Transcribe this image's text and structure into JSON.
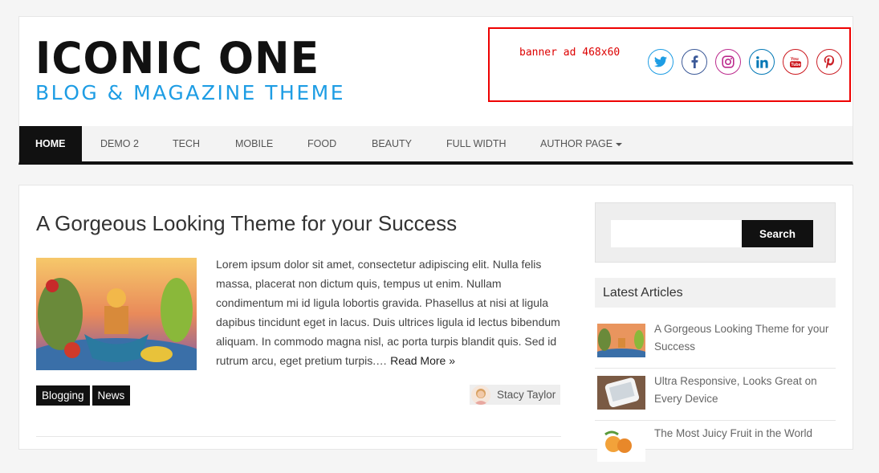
{
  "header": {
    "site_title": "ICONIC ONE",
    "tagline": "BLOG & MAGAZINE THEME",
    "banner_text": "banner ad 468x60",
    "social": [
      {
        "name": "twitter-icon",
        "glyph": "t",
        "color": "#1e9de4"
      },
      {
        "name": "facebook-icon",
        "glyph": "f",
        "color": "#3b5998"
      },
      {
        "name": "instagram-icon",
        "glyph": "◎",
        "color": "#bc2a8d"
      },
      {
        "name": "linkedin-icon",
        "glyph": "in",
        "color": "#0077b5"
      },
      {
        "name": "youtube-icon",
        "glyph": "▶",
        "color": "#cc181e"
      },
      {
        "name": "pinterest-icon",
        "glyph": "P",
        "color": "#cb2027"
      }
    ]
  },
  "nav": {
    "items": [
      "HOME",
      "DEMO 2",
      "TECH",
      "MOBILE",
      "FOOD",
      "BEAUTY",
      "FULL WIDTH",
      "AUTHOR PAGE"
    ]
  },
  "post": {
    "title": "A Gorgeous Looking Theme for your Success",
    "excerpt": "Lorem ipsum dolor sit amet, consectetur adipiscing elit. Nulla felis massa, placerat non dictum quis, tempus ut enim. Nullam condimentum mi id ligula lobortis gravida. Phasellus at nisi at ligula dapibus tincidunt eget in lacus. Duis ultrices ligula id lectus bibendum aliquam. In commodo magna nisl, ac porta turpis blandit quis. Sed id rutrum arcu, eget pretium turpis.…",
    "read_more": "Read More »",
    "tags": [
      "Blogging",
      "News"
    ],
    "author": "Stacy Taylor"
  },
  "sidebar": {
    "search_placeholder": "",
    "search_button": "Search",
    "latest_title": "Latest Articles",
    "latest": [
      {
        "title": "A Gorgeous Looking Theme for your Success"
      },
      {
        "title": "Ultra Responsive, Looks Great on Every Device"
      },
      {
        "title": "The Most Juicy Fruit in the World"
      }
    ]
  }
}
